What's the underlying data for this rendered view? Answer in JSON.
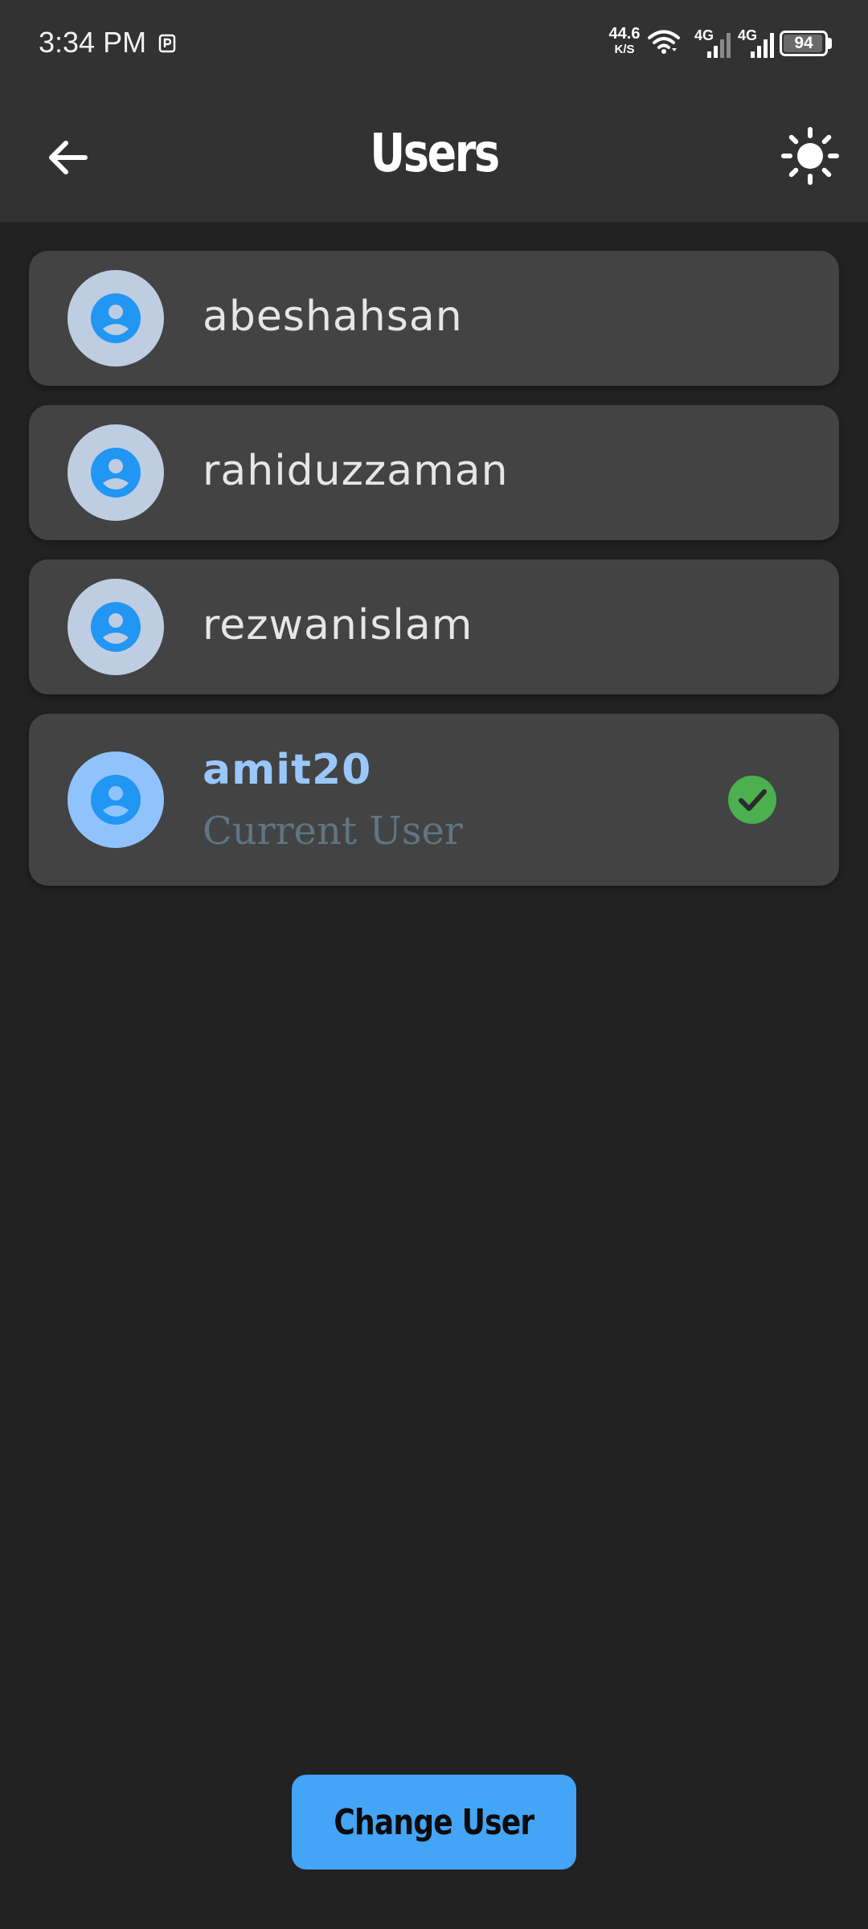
{
  "status_bar": {
    "time": "3:34 PM",
    "net_speed_value": "44.6",
    "net_speed_unit": "K/S",
    "sim1_label": "4G",
    "sim2_label": "4G",
    "battery": "94"
  },
  "app_bar": {
    "title": "Users",
    "back_icon": "arrow-left-icon",
    "theme_icon": "sun-icon"
  },
  "users": [
    {
      "name": "abeshahsan"
    },
    {
      "name": "rahiduzzaman"
    },
    {
      "name": "rezwanislam"
    },
    {
      "name": "amit20",
      "subtitle": "Current User",
      "current": true
    }
  ],
  "change_user_label": "Change User",
  "colors": {
    "background": "#222222",
    "app_bar": "#323232",
    "card": "#434343",
    "accent": "#44a4f5",
    "current_user_name": "#9ac7fb",
    "check_green": "#4caf50"
  }
}
